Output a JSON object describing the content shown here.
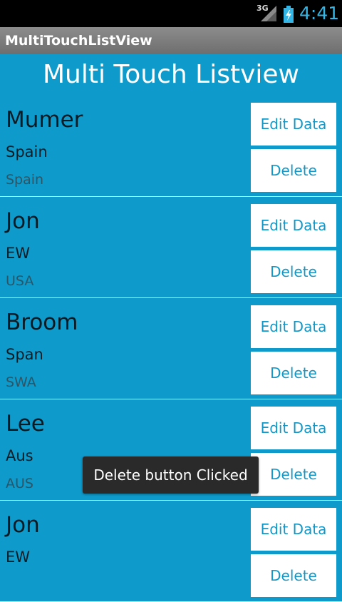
{
  "status_bar": {
    "network": "3G",
    "time": "4:41"
  },
  "app_title": "MultiTouchListView",
  "heading": "Multi Touch Listview",
  "rows": [
    {
      "name": "Mumer",
      "field1": "Spain",
      "field2": "Spain",
      "edit_label": "Edit Data",
      "delete_label": "Delete"
    },
    {
      "name": "Jon",
      "field1": "EW",
      "field2": "USA",
      "edit_label": "Edit Data",
      "delete_label": "Delete"
    },
    {
      "name": "Broom",
      "field1": "Span",
      "field2": "SWA",
      "edit_label": "Edit Data",
      "delete_label": "Delete"
    },
    {
      "name": "Lee",
      "field1": "Aus",
      "field2": "AUS",
      "edit_label": "Edit Data",
      "delete_label": "Delete"
    },
    {
      "name": "Jon",
      "field1": "EW",
      "field2": "",
      "edit_label": "Edit Data",
      "delete_label": "Delete"
    }
  ],
  "toast": "Delete button Clicked",
  "colors": {
    "background": "#0e9acb",
    "accent_text": "#1397c6",
    "clock": "#33b5e5"
  },
  "icons": [
    "signal-icon",
    "battery-charging-icon"
  ]
}
